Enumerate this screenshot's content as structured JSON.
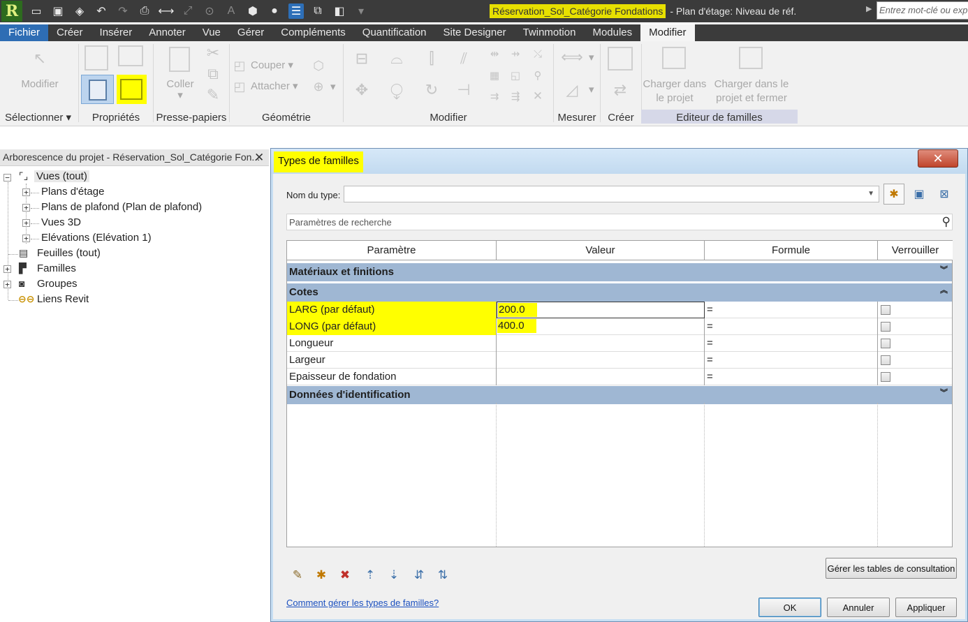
{
  "quick_access": {
    "app_logo": "R",
    "document_name": "Réservation_Sol_Catégorie Fondations",
    "view_name": "- Plan d'étage: Niveau de réf.",
    "search_placeholder": "Entrez mot-clé ou exp"
  },
  "tabs": [
    {
      "label": "Fichier"
    },
    {
      "label": "Créer"
    },
    {
      "label": "Insérer"
    },
    {
      "label": "Annoter"
    },
    {
      "label": "Vue"
    },
    {
      "label": "Gérer"
    },
    {
      "label": "Compléments"
    },
    {
      "label": "Quantification"
    },
    {
      "label": "Site Designer"
    },
    {
      "label": "Twinmotion"
    },
    {
      "label": "Modules"
    },
    {
      "label": "Modifier"
    }
  ],
  "ribbon": {
    "modify_label": "Modifier",
    "select_panel": "Sélectionner",
    "properties_panel": "Propriétés",
    "paste_label": "Coller",
    "clipboard_panel": "Presse-papiers",
    "cut_label": "Couper",
    "join_label": "Attacher",
    "geometry_panel": "Géométrie",
    "modify_panel": "Modifier",
    "measure_panel": "Mesurer",
    "create_panel": "Créer",
    "load_into_project": "Charger dans le projet",
    "load_into_project_close": "Charger dans le projet et fermer",
    "family_editor_panel": "Editeur de familles"
  },
  "project_browser": {
    "title": "Arborescence du projet - Réservation_Sol_Catégorie Fon...",
    "nodes": [
      {
        "label": "Vues (tout)"
      },
      {
        "label": "Plans d'étage"
      },
      {
        "label": "Plans de plafond (Plan de plafond)"
      },
      {
        "label": "Vues 3D"
      },
      {
        "label": "Elévations (Elévation 1)"
      },
      {
        "label": "Feuilles (tout)"
      },
      {
        "label": "Familles"
      },
      {
        "label": "Groupes"
      },
      {
        "label": "Liens Revit"
      }
    ]
  },
  "dialog": {
    "title": "Types de familles",
    "type_name_label": "Nom du type:",
    "type_name_value": "",
    "search_placeholder": "Paramètres de recherche",
    "columns": [
      "Paramètre",
      "Valeur",
      "Formule",
      "Verrouiller"
    ],
    "groups": {
      "materials": "Matériaux et finitions",
      "dimensions": "Cotes",
      "identity": "Données d'identification"
    },
    "rows": [
      {
        "param": "LARG (par défaut)",
        "value": "200.0",
        "formula": "=",
        "highlight": true
      },
      {
        "param": "LONG (par défaut)",
        "value": "400.0",
        "formula": "=",
        "highlight": true
      },
      {
        "param": "Longueur",
        "value": "",
        "formula": "=",
        "highlight": false
      },
      {
        "param": "Largeur",
        "value": "",
        "formula": "=",
        "highlight": false
      },
      {
        "param": "Epaisseur de fondation",
        "value": "",
        "formula": "=",
        "highlight": false
      }
    ],
    "lookup_button": "Gérer les tables de consultation",
    "help_link": "Comment gérer les types de familles?",
    "ok": "OK",
    "cancel": "Annuler",
    "apply": "Appliquer"
  },
  "colors": {
    "highlight": "#ffff00",
    "group_row": "#9fb7d3",
    "file_tab": "#2e6db4"
  }
}
